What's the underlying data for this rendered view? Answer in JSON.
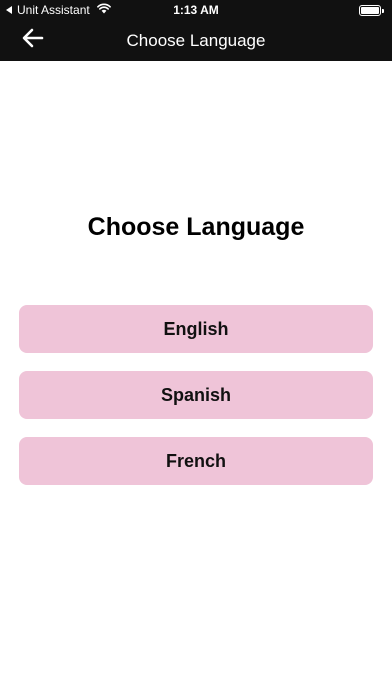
{
  "status_bar": {
    "back_app": "Unit Assistant",
    "time": "1:13 AM"
  },
  "nav": {
    "title": "Choose Language"
  },
  "main": {
    "heading": "Choose Language",
    "languages": [
      "English",
      "Spanish",
      "French"
    ]
  },
  "colors": {
    "bar_background": "#111111",
    "button_background": "#efc4d8"
  },
  "icons": {
    "back": "arrow-left-icon",
    "wifi": "wifi-icon",
    "battery": "battery-icon"
  }
}
